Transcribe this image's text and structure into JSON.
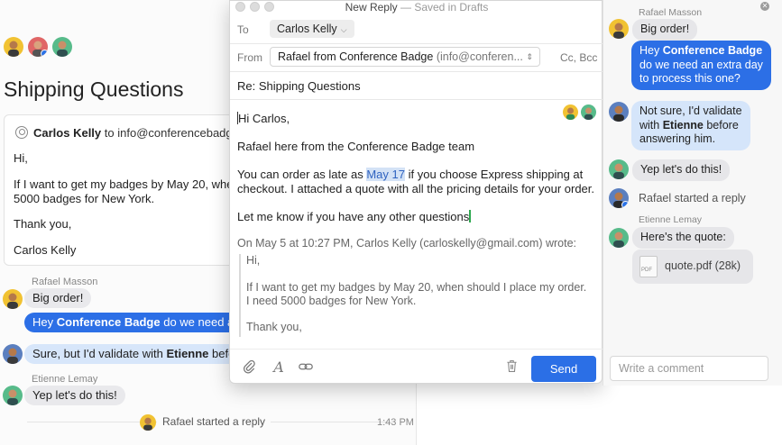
{
  "back": {
    "title": "Shipping Questions",
    "email": {
      "sender": "Carlos Kelly",
      "to_text": "to info@conferencebadge",
      "lines": [
        "Hi,",
        "If I want to get my badges by May 20, when",
        "5000 badges for New York.",
        "Thank you,",
        "Carlos Kelly"
      ]
    },
    "chat": [
      {
        "name": "Rafael Masson",
        "text": "Big order!"
      },
      {
        "name": "",
        "pre": "Hey ",
        "bold": "Conference Badge",
        "post": " do we need an"
      },
      {
        "name": "",
        "pre": "Sure, but I'd validate with ",
        "bold": "Etienne",
        "post": " befo"
      },
      {
        "name": "Etienne Lemay",
        "text": "Yep let's do this!"
      }
    ],
    "footer_text": "Rafael started a reply",
    "footer_time": "1:43 PM"
  },
  "compose": {
    "title": "New Reply",
    "title_sub": " — Saved in Drafts",
    "to_label": "To",
    "to_value": "Carlos Kelly",
    "from_label": "From",
    "from_name": "Rafael from Conference Badge",
    "from_email": "(info@conferen...",
    "cc_bcc": "Cc, Bcc",
    "subject": "Re: Shipping Questions",
    "body": {
      "greeting": "Hi Carlos,",
      "line1": "Rafael here from the Conference Badge team",
      "line2_pre": "You can order as late as ",
      "line2_hl": "May 17",
      "line2_post": " if you choose Express shipping at",
      "line3": "checkout. I attached a quote with all the pricing details for your order.",
      "line4": "Let me know if you have any other questions"
    },
    "quote": {
      "header": "On May 5 at 10:27 PM, Carlos Kelly (carloskelly@gmail.com) wrote:",
      "lines": [
        "Hi,",
        "If I want to get my badges by May 20, when should I place my order.",
        "I need 5000 badges for New York.",
        "Thank you,"
      ]
    },
    "send_label": "Send"
  },
  "chat": {
    "messages": [
      {
        "name": "Rafael Masson",
        "text": "Big order!"
      },
      {
        "pre": "Hey ",
        "bold": "Conference Badge",
        "l1post": "",
        "l2": "do we need an extra day",
        "l3": "to process this one?"
      },
      {
        "l1": "Not sure, I'd validate",
        "l2pre": "with ",
        "l2bold": "Etienne",
        "l2post": " before",
        "l3": "answering him."
      },
      {
        "text": "Yep let's do this!"
      },
      {
        "text": "Rafael started a reply"
      },
      {
        "name": "Etienne Lemay",
        "text": "Here's the quote:"
      }
    ],
    "file_name": "quote.pdf (28k)",
    "comment_placeholder": "Write a comment"
  },
  "colors": {
    "accent": "#2b6fe6",
    "light_blue": "#d5e5fa",
    "gray_bubble": "#e6e6e9"
  }
}
